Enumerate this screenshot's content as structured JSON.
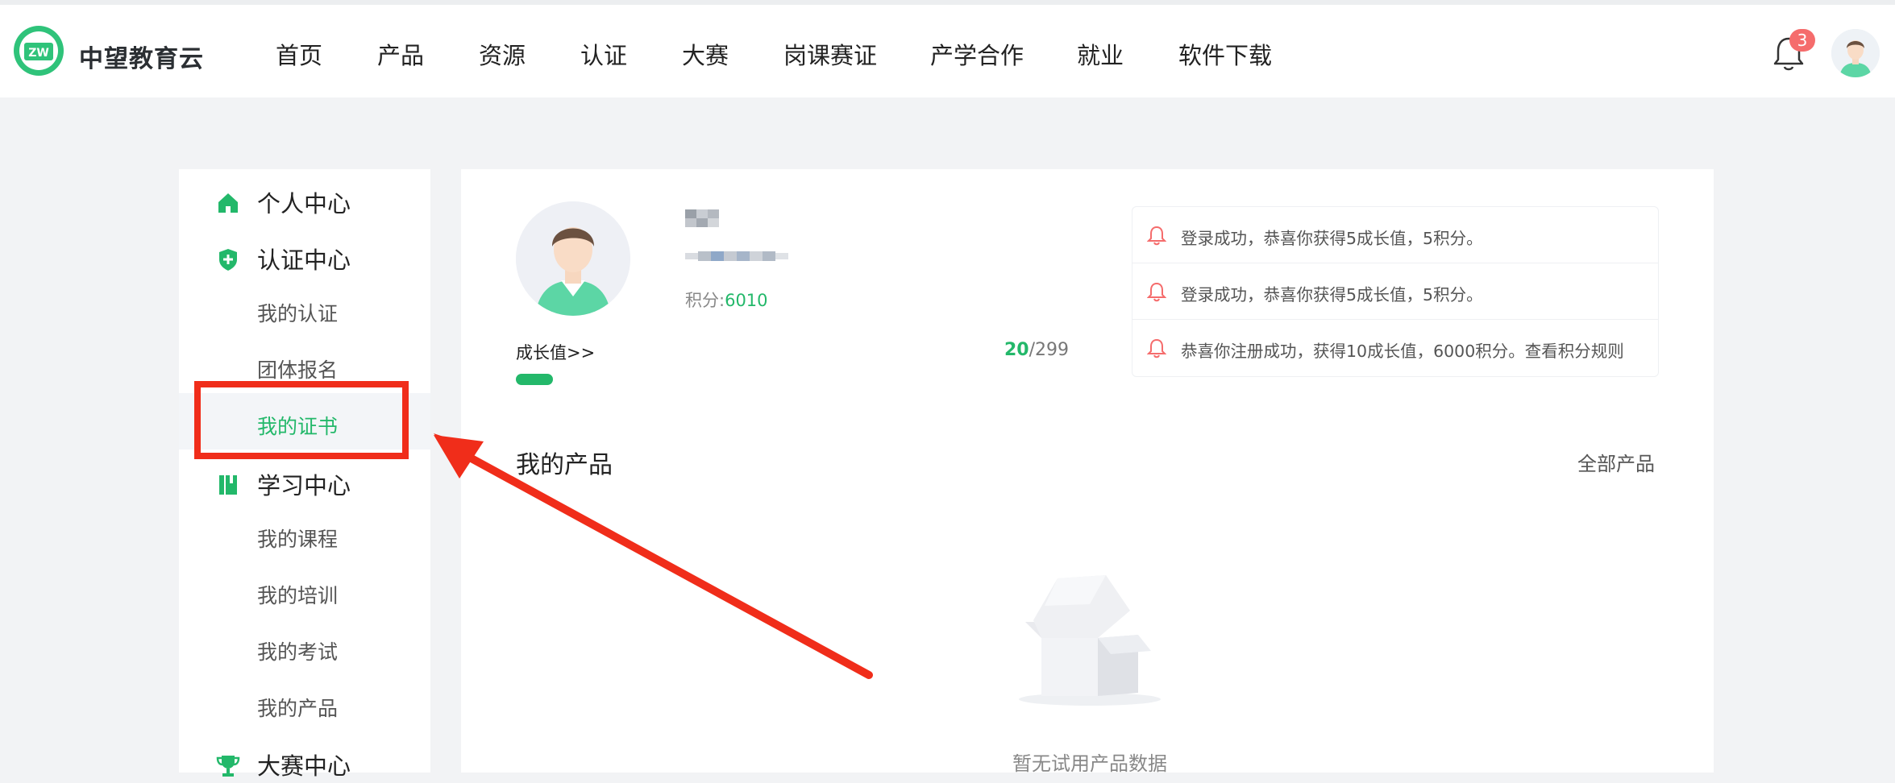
{
  "header": {
    "brand": "中望教育云",
    "logo_text": "ZW",
    "nav": [
      {
        "label": "首页"
      },
      {
        "label": "产品"
      },
      {
        "label": "资源"
      },
      {
        "label": "认证"
      },
      {
        "label": "大赛"
      },
      {
        "label": "岗课赛证"
      },
      {
        "label": "产学合作"
      },
      {
        "label": "就业"
      },
      {
        "label": "软件下载"
      }
    ],
    "notification_count": "3",
    "icons": {
      "bell": "bell-icon",
      "avatar": "avatar"
    }
  },
  "sidebar": {
    "groups": [
      {
        "label": "个人中心",
        "icon": "home-icon"
      },
      {
        "label": "认证中心",
        "icon": "shield-plus-icon"
      },
      {
        "label": "学习中心",
        "icon": "book-icon"
      },
      {
        "label": "大赛中心",
        "icon": "trophy-icon"
      }
    ],
    "cert_items": [
      "我的认证",
      "团体报名",
      "我的证书"
    ],
    "study_items": [
      "我的课程",
      "我的培训",
      "我的考试",
      "我的产品"
    ],
    "active_item": "我的证书"
  },
  "profile": {
    "points_label": "积分:",
    "points_value": "6010",
    "growth_link": "成长值>>",
    "growth_current": "20",
    "growth_total": "/299",
    "growth_fraction": 0.067
  },
  "messages": [
    {
      "text": "登录成功，恭喜你获得5成长值，5积分。"
    },
    {
      "text": "登录成功，恭喜你获得5成长值，5积分。"
    },
    {
      "text": "恭喜你注册成功，获得10成长值，6000积分。查看积分规则"
    }
  ],
  "products": {
    "title": "我的产品",
    "all_link": "全部产品",
    "empty_text": "暂无试用产品数据"
  },
  "colors": {
    "accent": "#23b86a",
    "annotation": "#f02d1a",
    "badge": "#f56c6c"
  }
}
